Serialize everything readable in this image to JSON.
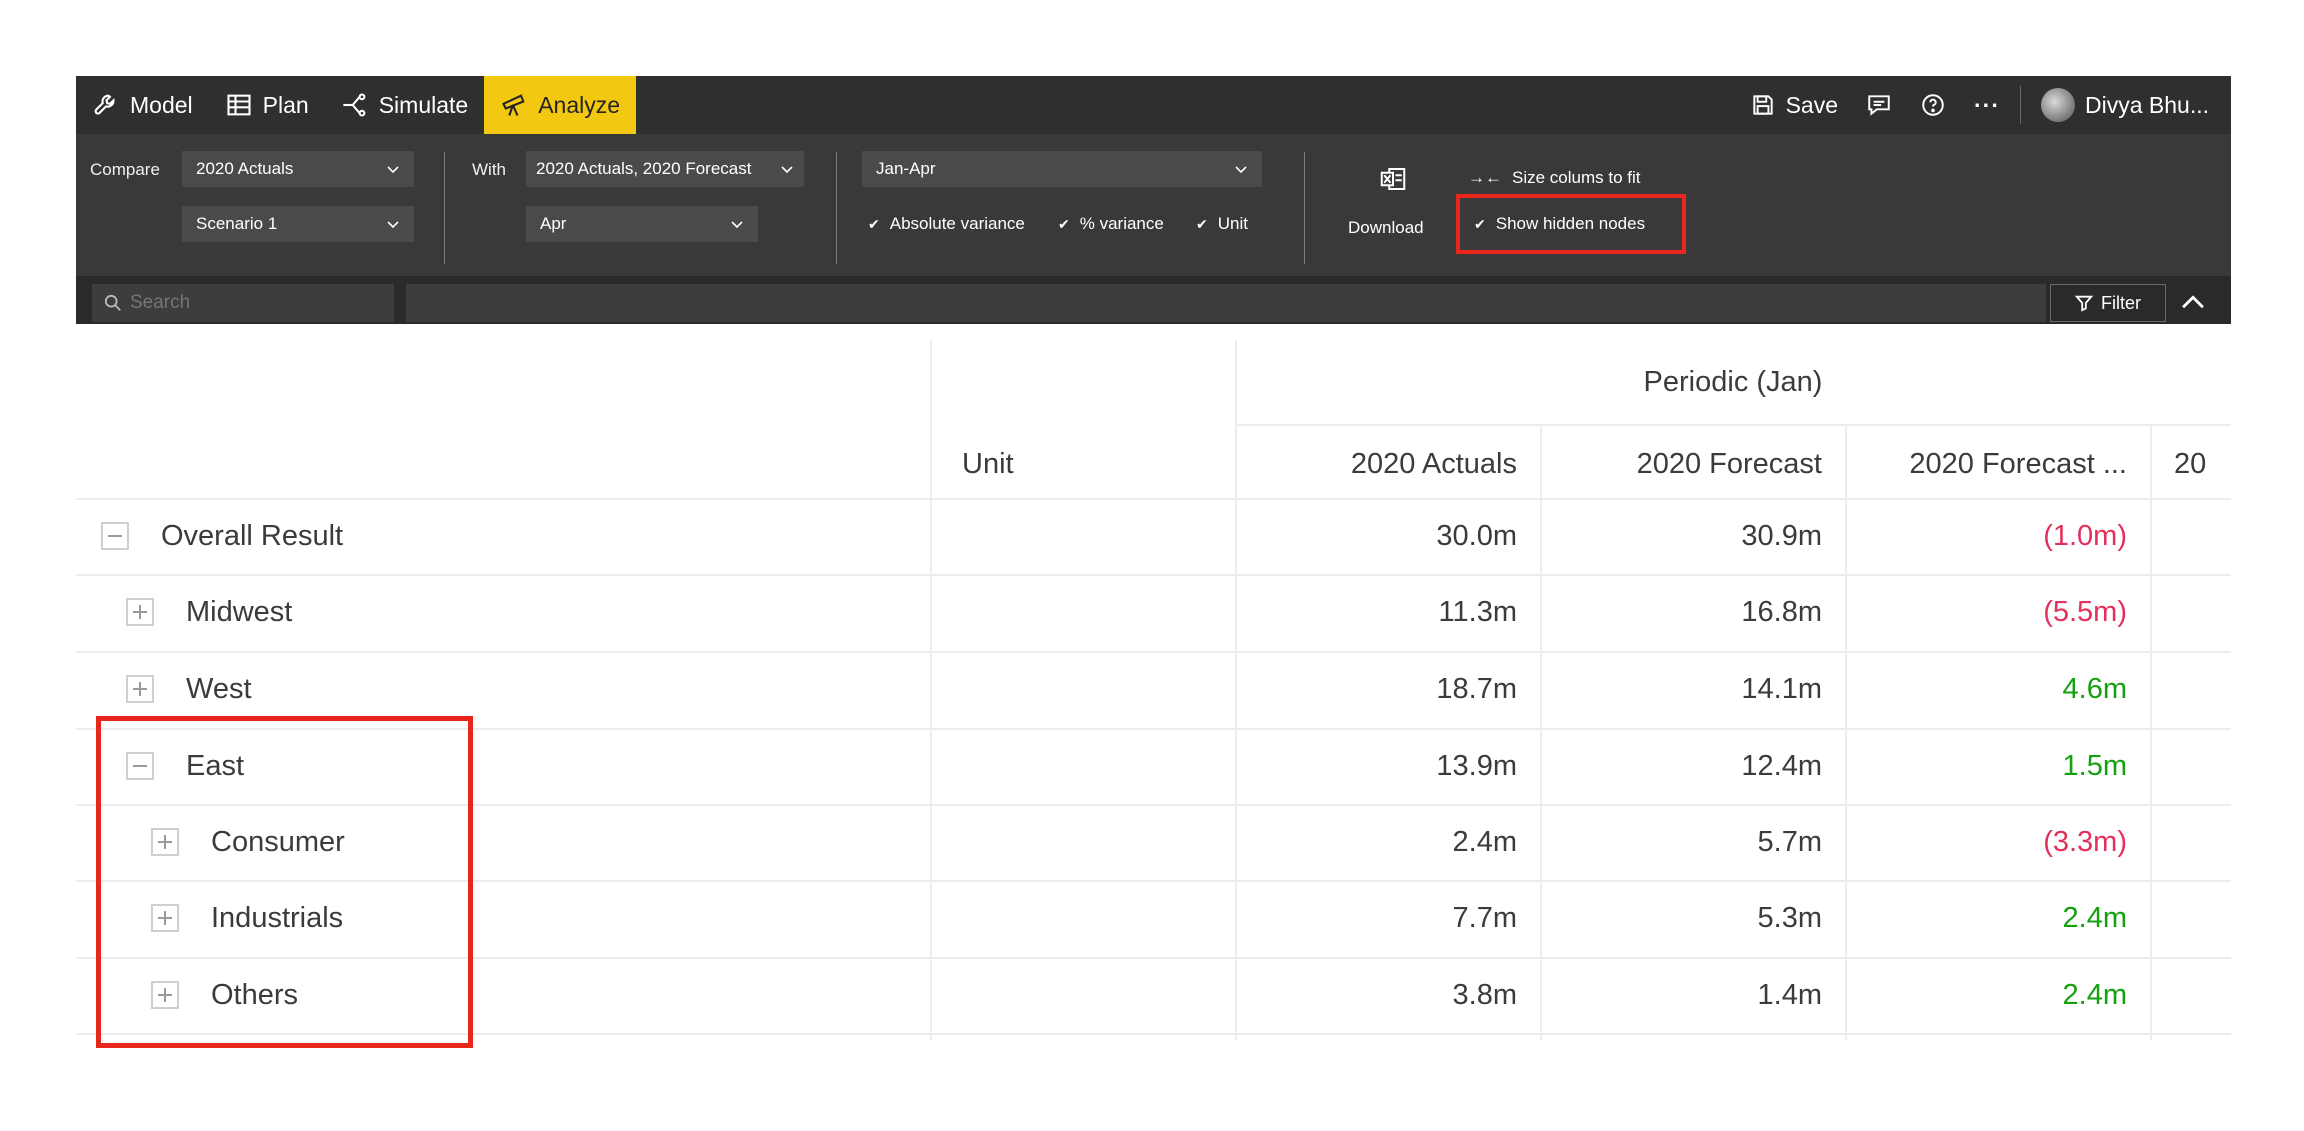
{
  "nav": {
    "items": [
      {
        "label": "Model"
      },
      {
        "label": "Plan"
      },
      {
        "label": "Simulate"
      },
      {
        "label": "Analyze"
      }
    ],
    "save_label": "Save",
    "more_label": "···",
    "user_name": "Divya Bhu..."
  },
  "ribbon": {
    "compare_label": "Compare",
    "compare_value": "2020 Actuals",
    "scenario_value": "Scenario 1",
    "with_label": "With",
    "with_value": "2020 Actuals, 2020 Forecast",
    "month_value": "Apr",
    "range_value": "Jan-Apr",
    "abs_variance_label": "Absolute variance",
    "pct_variance_label": "% variance",
    "unit_label": "Unit",
    "download_label": "Download",
    "size_columns_label": "Size colums to fit",
    "show_hidden_label": "Show hidden nodes"
  },
  "search": {
    "placeholder": "Search"
  },
  "filter_label": "Filter",
  "grid": {
    "group_header": "Periodic (Jan)",
    "unit_header": "Unit",
    "col_headers": [
      "2020 Actuals",
      "2020 Forecast",
      "2020 Forecast ...",
      "20"
    ],
    "rows": [
      {
        "label": "Overall Result",
        "actuals": "30.0m",
        "forecast": "30.9m",
        "variance": "(1.0m)"
      },
      {
        "label": "Midwest",
        "actuals": "11.3m",
        "forecast": "16.8m",
        "variance": "(5.5m)"
      },
      {
        "label": "West",
        "actuals": "18.7m",
        "forecast": "14.1m",
        "variance": "4.6m"
      },
      {
        "label": "East",
        "actuals": "13.9m",
        "forecast": "12.4m",
        "variance": "1.5m"
      },
      {
        "label": "Consumer",
        "actuals": "2.4m",
        "forecast": "5.7m",
        "variance": "(3.3m)"
      },
      {
        "label": "Industrials",
        "actuals": "7.7m",
        "forecast": "5.3m",
        "variance": "2.4m"
      },
      {
        "label": "Others",
        "actuals": "3.8m",
        "forecast": "1.4m",
        "variance": "2.4m"
      }
    ]
  },
  "colors": {
    "accent": "#f2c811",
    "positive": "#13a10e",
    "negative": "#e3315c",
    "highlight": "#e8261b"
  }
}
